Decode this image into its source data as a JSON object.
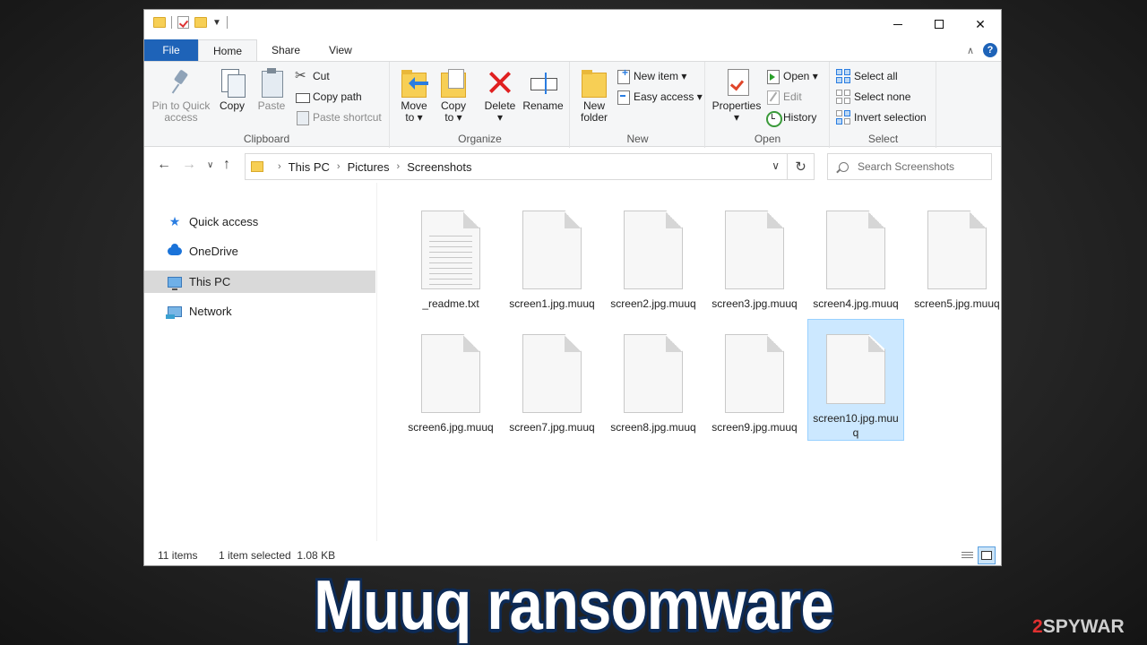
{
  "window": {
    "tabs": {
      "file": "File",
      "home": "Home",
      "share": "Share",
      "view": "View"
    },
    "help": "?"
  },
  "ribbon": {
    "clipboard": {
      "label": "Clipboard",
      "pin": "Pin to Quick access",
      "pin_l1": "Pin to Quick",
      "pin_l2": "access",
      "copy": "Copy",
      "paste": "Paste",
      "cut": "Cut",
      "copy_path": "Copy path",
      "paste_shortcut": "Paste shortcut"
    },
    "organize": {
      "label": "Organize",
      "move_l1": "Move",
      "move_l2": "to ▾",
      "copy_l1": "Copy",
      "copy_l2": "to ▾",
      "delete_l1": "Delete",
      "delete_l2": "▾",
      "rename": "Rename"
    },
    "new": {
      "label": "New",
      "new_folder_l1": "New",
      "new_folder_l2": "folder",
      "new_item": "New item ▾",
      "easy_access": "Easy access ▾"
    },
    "open": {
      "label": "Open",
      "properties_l1": "Properties",
      "properties_l2": "▾",
      "open": "Open ▾",
      "edit": "Edit",
      "history": "History"
    },
    "select": {
      "label": "Select",
      "select_all": "Select all",
      "select_none": "Select none",
      "invert_selection": "Invert selection"
    }
  },
  "address": {
    "crumbs": [
      "This PC",
      "Pictures",
      "Screenshots"
    ],
    "search_placeholder": "Search Screenshots"
  },
  "nav": {
    "items": [
      {
        "label": "Quick access",
        "icon": "star-icon"
      },
      {
        "label": "OneDrive",
        "icon": "cloud-icon"
      },
      {
        "label": "This PC",
        "icon": "monitor-icon",
        "selected": true
      },
      {
        "label": "Network",
        "icon": "network-icon"
      }
    ]
  },
  "files": [
    {
      "name": "_readme.txt",
      "type": "text"
    },
    {
      "name": "screen1.jpg.muuq",
      "type": "blank"
    },
    {
      "name": "screen2.jpg.muuq",
      "type": "blank"
    },
    {
      "name": "screen3.jpg.muuq",
      "type": "blank"
    },
    {
      "name": "screen4.jpg.muuq",
      "type": "blank"
    },
    {
      "name": "screen5.jpg.muuq",
      "type": "blank"
    },
    {
      "name": "screen6.jpg.muuq",
      "type": "blank"
    },
    {
      "name": "screen7.jpg.muuq",
      "type": "blank"
    },
    {
      "name": "screen8.jpg.muuq",
      "type": "blank"
    },
    {
      "name": "screen9.jpg.muuq",
      "type": "blank"
    },
    {
      "name": "screen10.jpg.muuq",
      "type": "blank",
      "selected": true
    }
  ],
  "status": {
    "item_count": "11 items",
    "selection": "1 item selected  1.08 KB"
  },
  "banner": "Muuq ransomware",
  "watermark": {
    "two": "2",
    "rest": "SPYWAR"
  },
  "colors": {
    "accent": "#1e63b8",
    "selection_bg": "#cce8ff",
    "selection_border": "#99d1ff",
    "banner_outline": "#0d2a55"
  }
}
